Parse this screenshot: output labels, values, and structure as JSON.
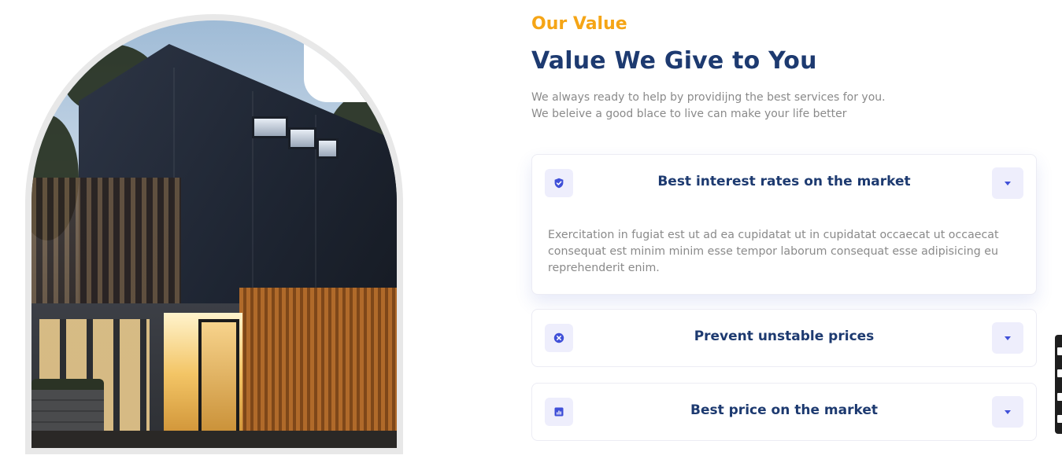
{
  "section": {
    "eyebrow": "Our Value",
    "heading": "Value We Give to You",
    "intro_line_1": "We always ready to help by providijng the best services for you.",
    "intro_line_2": "We beleive a good blace to live can make your life better"
  },
  "accordion": [
    {
      "icon": "shield-check-icon",
      "title": "Best interest rates on the market",
      "expanded": true,
      "body": "Exercitation in fugiat est ut ad ea cupidatat ut in cupidatat occaecat ut occaecat consequat est minim minim esse tempor laborum consequat esse adipisicing eu reprehenderit enim."
    },
    {
      "icon": "x-circle-icon",
      "title": "Prevent unstable prices",
      "expanded": false
    },
    {
      "icon": "bar-chart-icon",
      "title": "Best price on the market",
      "expanded": false
    }
  ],
  "colors": {
    "accent": "#f5a516",
    "heading": "#1d3a70",
    "icon": "#4050d8",
    "icon_bg": "#eeeefc",
    "muted_text": "#8a8a8a"
  }
}
